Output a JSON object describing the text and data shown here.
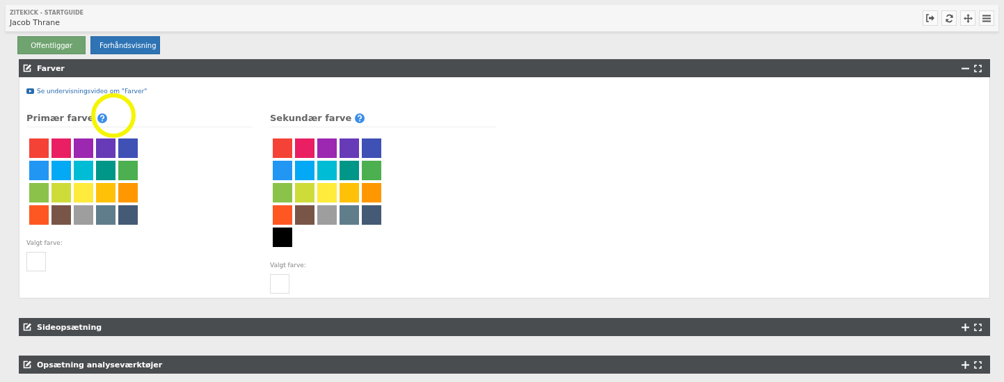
{
  "header": {
    "subtitle": "ZITEKICK - STARTGUIDE",
    "title": "Jacob Thrane"
  },
  "toolbar": {
    "buttons": [
      {
        "label": "Offentliggør",
        "kind": "success"
      },
      {
        "label": "Forhåndsvisning",
        "kind": "primary"
      }
    ]
  },
  "panels": [
    {
      "title": "Farver",
      "expanded": true,
      "video_link": "Se undervisningsvideo om \"Farver\"",
      "pickers": [
        {
          "heading": "Primær farve",
          "selected_label": "Valgt farve:",
          "swatches": [
            {
              "color": "#f44336"
            },
            {
              "color": "#e91e63"
            },
            {
              "color": "#9c27b0"
            },
            {
              "color": "#673ab7"
            },
            {
              "color": "#3f51b5"
            },
            {
              "color": "#2196f3"
            },
            {
              "color": "#03a9f4"
            },
            {
              "color": "#00bcd4"
            },
            {
              "color": "#009688"
            },
            {
              "color": "#4caf50"
            },
            {
              "color": "#8bc34a"
            },
            {
              "color": "#cddc39"
            },
            {
              "color": "#ffeb3b"
            },
            {
              "color": "#ffc107"
            },
            {
              "color": "#ff9800"
            },
            {
              "color": "#ff5722"
            },
            {
              "color": "#795548"
            },
            {
              "color": "#9e9e9e"
            },
            {
              "color": "#607d8b"
            },
            {
              "color": "#455a75"
            }
          ]
        },
        {
          "heading": "Sekundær farve",
          "selected_label": "Valgt farve:",
          "swatches": [
            {
              "color": "#f44336"
            },
            {
              "color": "#e91e63"
            },
            {
              "color": "#9c27b0"
            },
            {
              "color": "#673ab7"
            },
            {
              "color": "#3f51b5"
            },
            {
              "color": "#2196f3"
            },
            {
              "color": "#03a9f4"
            },
            {
              "color": "#00bcd4"
            },
            {
              "color": "#009688"
            },
            {
              "color": "#4caf50"
            },
            {
              "color": "#8bc34a"
            },
            {
              "color": "#cddc39"
            },
            {
              "color": "#ffeb3b"
            },
            {
              "color": "#ffc107"
            },
            {
              "color": "#ff9800"
            },
            {
              "color": "#ff5722"
            },
            {
              "color": "#795548"
            },
            {
              "color": "#9e9e9e"
            },
            {
              "color": "#607d8b"
            },
            {
              "color": "#455a75"
            },
            {
              "color": "#000000"
            }
          ]
        }
      ]
    },
    {
      "title": "Sideopsætning",
      "expanded": false
    },
    {
      "title": "Opsætning analyseværktøjer",
      "expanded": false
    }
  ]
}
